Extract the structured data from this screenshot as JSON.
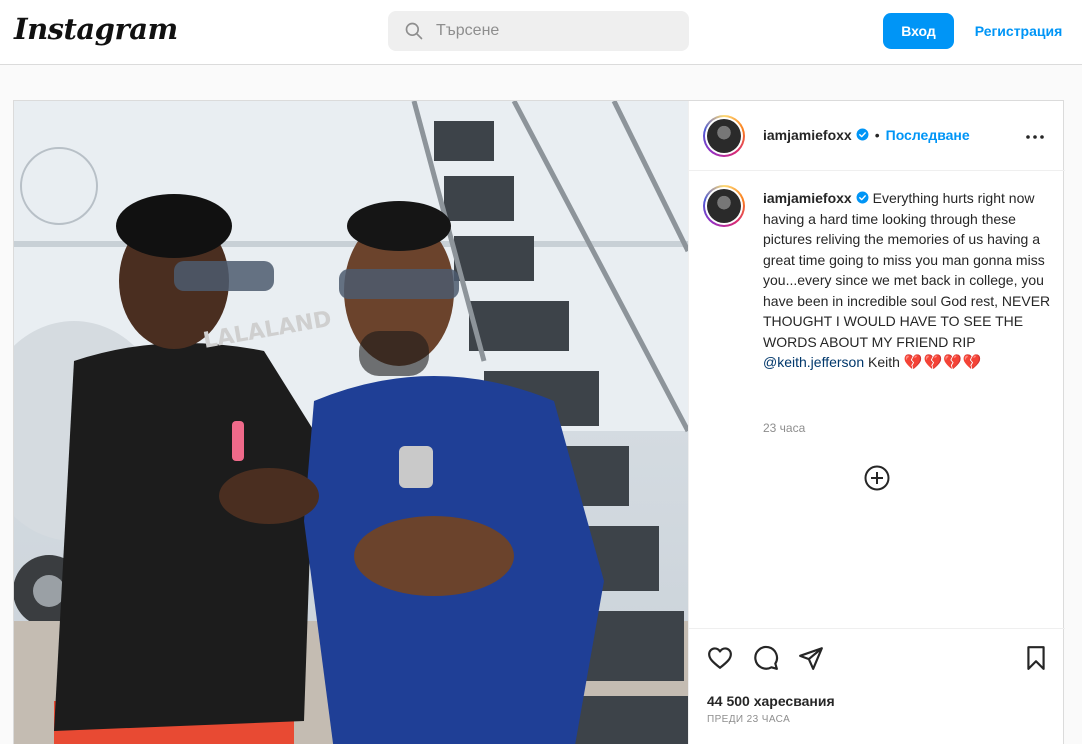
{
  "header": {
    "logo": "Instagram",
    "search_placeholder": "Търсене",
    "login_label": "Вход",
    "register_label": "Регистрация"
  },
  "post": {
    "username": "iamjamiefoxx",
    "follow_label": "Последване",
    "dot": "•",
    "caption": {
      "username": "iamjamiefoxx",
      "text": "Everything hurts right now having a hard time looking through these pictures reliving the memories of us having a great time going to miss you man gonna miss you...every since we met back in college, you have been in incredible soul God rest, NEVER THOUGHT I WOULD HAVE TO SEE THE WORDS ABOUT MY FRIEND RIP",
      "mention": "@keith.jefferson",
      "after_mention": "Keith",
      "hearts": "💔💔💔💔"
    },
    "comment_time": "23 часа",
    "likes": "44 500 харесвания",
    "posted_ago": "ПРЕДИ 23 ЧАСА",
    "shirt_text": "LALALAND"
  },
  "icons": {
    "search": "search-icon",
    "verified": "verified-badge-icon",
    "more": "more-options-icon",
    "load_more": "plus-circle-icon",
    "like": "heart-icon",
    "comment": "comment-icon",
    "share": "share-icon",
    "save": "bookmark-icon"
  },
  "colors": {
    "accent": "#0095f6",
    "mention": "#00376b",
    "muted": "#8e8e8e",
    "border": "#dbdbdb"
  }
}
